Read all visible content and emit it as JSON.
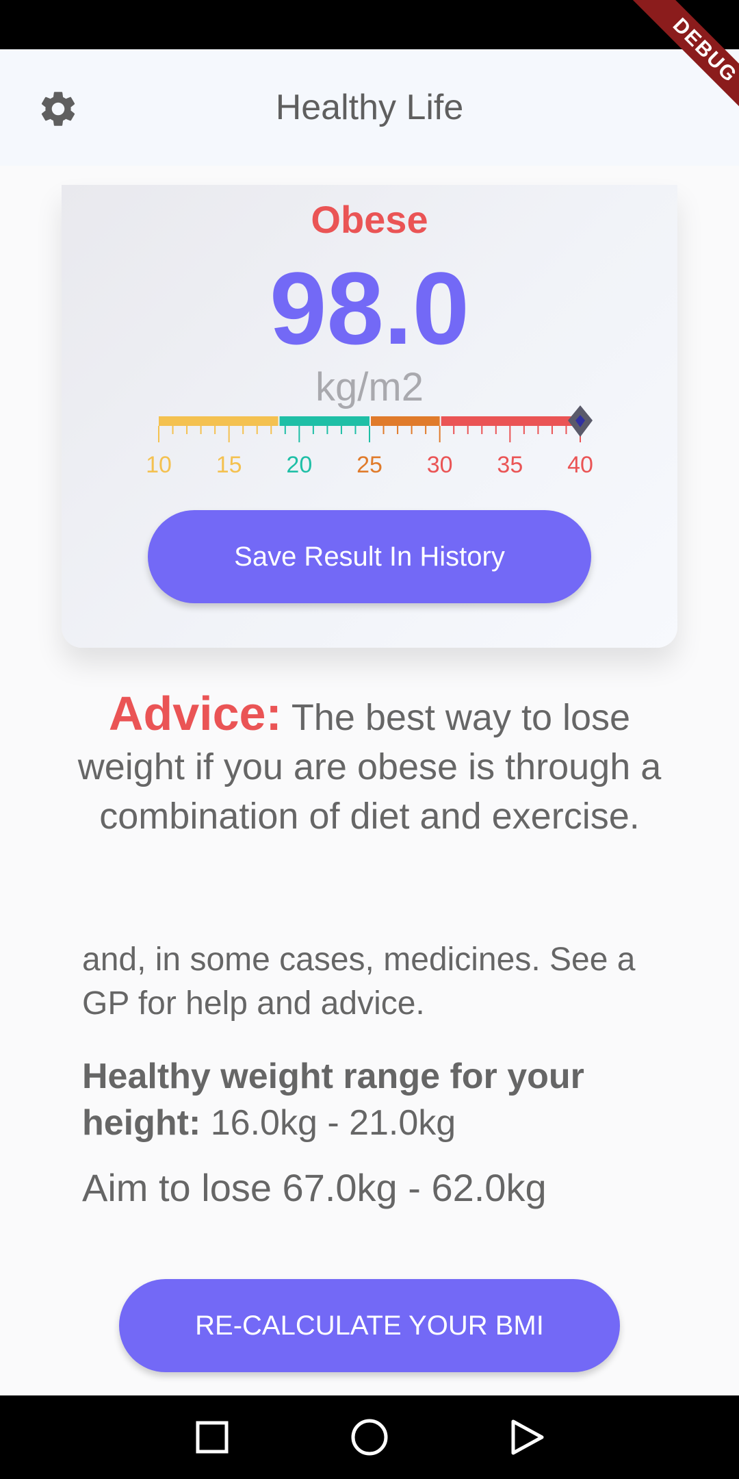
{
  "app_bar": {
    "title": "Healthy Life",
    "settings_icon": "gear-icon",
    "debug_banner": "DEBUG"
  },
  "result": {
    "category": "Obese",
    "bmi": "98.0",
    "unit": "kg/m2",
    "save_label": "Save Result In History",
    "colors": {
      "category": "#ea5455",
      "bmi": "#7369f6"
    }
  },
  "gauge": {
    "min": 10,
    "max": 40,
    "pointer_value": 40,
    "tick_labels": [
      {
        "text": "10",
        "value": 10,
        "color": "#f4c150"
      },
      {
        "text": "15",
        "value": 15,
        "color": "#f4c150"
      },
      {
        "text": "20",
        "value": 20,
        "color": "#1fbfa6"
      },
      {
        "text": "25",
        "value": 25,
        "color": "#e07b2b"
      },
      {
        "text": "30",
        "value": 30,
        "color": "#ea5455"
      },
      {
        "text": "35",
        "value": 35,
        "color": "#ea5455"
      },
      {
        "text": "40",
        "value": 40,
        "color": "#ea5455"
      }
    ],
    "ranges": [
      {
        "from": 10,
        "to": 18.5,
        "color": "#f4c150"
      },
      {
        "from": 18.5,
        "to": 25,
        "color": "#1fbfa6"
      },
      {
        "from": 25,
        "to": 30,
        "color": "#e07b2b"
      },
      {
        "from": 30,
        "to": 40,
        "color": "#ea5455"
      }
    ]
  },
  "advice": {
    "label": "Advice:",
    "text": "The best way to lose weight if you are obese is through a combination of diet and exercise.",
    "more": "and, in some cases, medicines. See a GP for help and advice."
  },
  "healthy_range": {
    "label": "Healthy weight range for your height:",
    "value": "16.0kg - 21.0kg"
  },
  "aim": "Aim to lose 67.0kg - 62.0kg",
  "recalculate_label": "RE-CALCULATE YOUR BMI",
  "nav": {
    "recents_icon": "square-icon",
    "home_icon": "circle-icon",
    "back_icon": "triangle-back-icon"
  }
}
